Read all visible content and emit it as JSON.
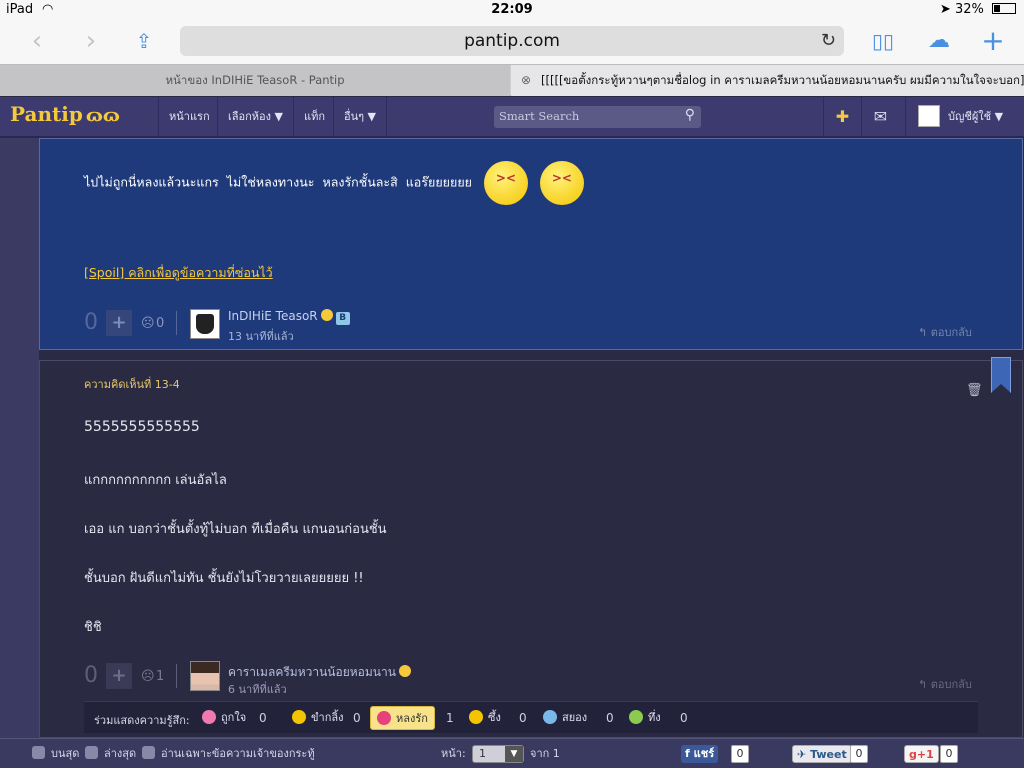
{
  "status_bar": {
    "device": "iPad",
    "time": "22:09",
    "battery": "32%",
    "battery_level": 0.32
  },
  "browser": {
    "url": "pantip.com",
    "tabs": [
      {
        "label": "หน้าของ InDIHiE TeasoR - Pantip"
      },
      {
        "label": "[[[[[ขอตั้งกระทู้หวานๆตามชื่อlog in คาราเมลครีมหวานน้อยหอมนานครับ ผมมีความในใจจะบอก]]]]] - Pa..."
      }
    ]
  },
  "header": {
    "logo": "Pantip",
    "logo_mark": "ɷɷ",
    "nav": [
      "หน้าแรก",
      "เลือกห้อง ▼",
      "แท็ก",
      "อื่นๆ ▼"
    ],
    "search_placeholder": "Smart Search",
    "account_label": "บัญชีผู้ใช้ ▼"
  },
  "comment1": {
    "text": "ไปไม่ถูกนี่หลงแล้วนะแกร   ไม่ใช่หลงทางนะ    หลงรักชั้นละสิ   แอร๊ยยยยยย",
    "spoil_link": "[Spoil] คลิกเพื่อดูข้อความที่ซ่อนไว้",
    "score": "0",
    "emotion_count": "0",
    "author": "InDIHiE TeasoR",
    "author_badge": "B",
    "time_ago": "13 นาทีที่แล้ว",
    "reply_label": "ตอบกลับ"
  },
  "comment2": {
    "heading": "ความคิดเห็นที่ 13-4",
    "lines": [
      "5555555555555",
      "แกกกกกกกกกก เล่นอัลไล",
      "เออ แก บอกว่าชั้นตั้งทู้ไม่บอก ทีเมื่อคืน แกนอนก่อนชั้น",
      "ชั้นบอก ฝันดีแกไม่ทัน ชั้นยังไม่โวยวายเลยยยยย !!",
      "ชิชิ"
    ],
    "score": "0",
    "emotion_count": "1",
    "author": "คาราเมลครีมหวานน้อยหอมนาน",
    "time_ago": "6 นาทีที่แล้ว",
    "reply_label": "ตอบกลับ",
    "emotion_bar": {
      "title": "ร่วมแสดงความรู้สึก:",
      "items": [
        {
          "label": "ถูกใจ",
          "count": "0",
          "color": "#f07ab0"
        },
        {
          "label": "ขำกลิ้ง",
          "count": "0",
          "color": "#f5c400"
        },
        {
          "label": "หลงรัก",
          "count": "1",
          "color": "#e8407a"
        },
        {
          "label": "ซึ้ง",
          "count": "0",
          "color": "#f5c400"
        },
        {
          "label": "สยอง",
          "count": "0",
          "color": "#7ab8e8"
        },
        {
          "label": "ทึ่ง",
          "count": "0",
          "color": "#8acb50"
        }
      ]
    }
  },
  "bottom_bar": {
    "top_label": "บนสุด",
    "bottom_label": "ล่างสุด",
    "owner_only_label": "อ่านเฉพาะข้อความเจ้าของกระทู้",
    "page_label": "หน้า:",
    "page_value": "1",
    "of_label": "จาก 1",
    "fb_label": "แชร์",
    "fb_count": "0",
    "tweet_label": "Tweet",
    "tweet_count": "0",
    "gplus_label": "g+1",
    "gplus_count": "0"
  }
}
